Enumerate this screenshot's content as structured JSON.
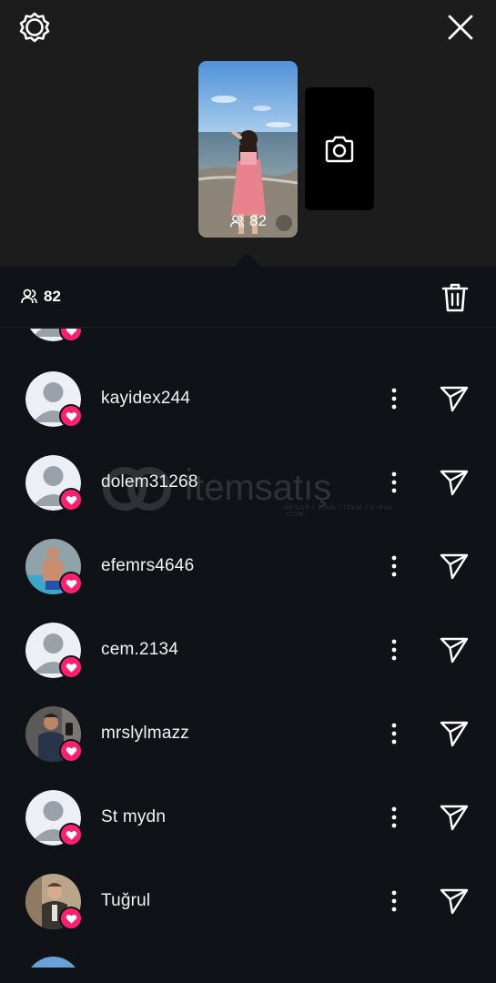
{
  "header": {
    "settings_icon": "gear-icon",
    "close_icon": "close-icon"
  },
  "story": {
    "viewer_count": "82",
    "camera_icon": "camera-icon"
  },
  "viewers_bar": {
    "count": "82",
    "people_icon": "people-icon",
    "delete_icon": "trash-icon"
  },
  "viewers": [
    {
      "username": "kayidex244",
      "avatar": "default"
    },
    {
      "username": "dolem31268",
      "avatar": "default"
    },
    {
      "username": "efemrs4646",
      "avatar": "photo"
    },
    {
      "username": "cem.2134",
      "avatar": "default"
    },
    {
      "username": "mrslylmazz",
      "avatar": "photo"
    },
    {
      "username": "St mydn",
      "avatar": "default"
    },
    {
      "username": "Tuğrul",
      "avatar": "photo"
    }
  ],
  "watermark": {
    "text": "İtemsatış",
    "sub": "HESAP / İLAN / İTEM / E-PİN .COM"
  },
  "colors": {
    "background": "#0f1217",
    "top_panel": "#1c1c1c",
    "like_badge": "#ff1f6f",
    "text": "#f5f5f5"
  }
}
